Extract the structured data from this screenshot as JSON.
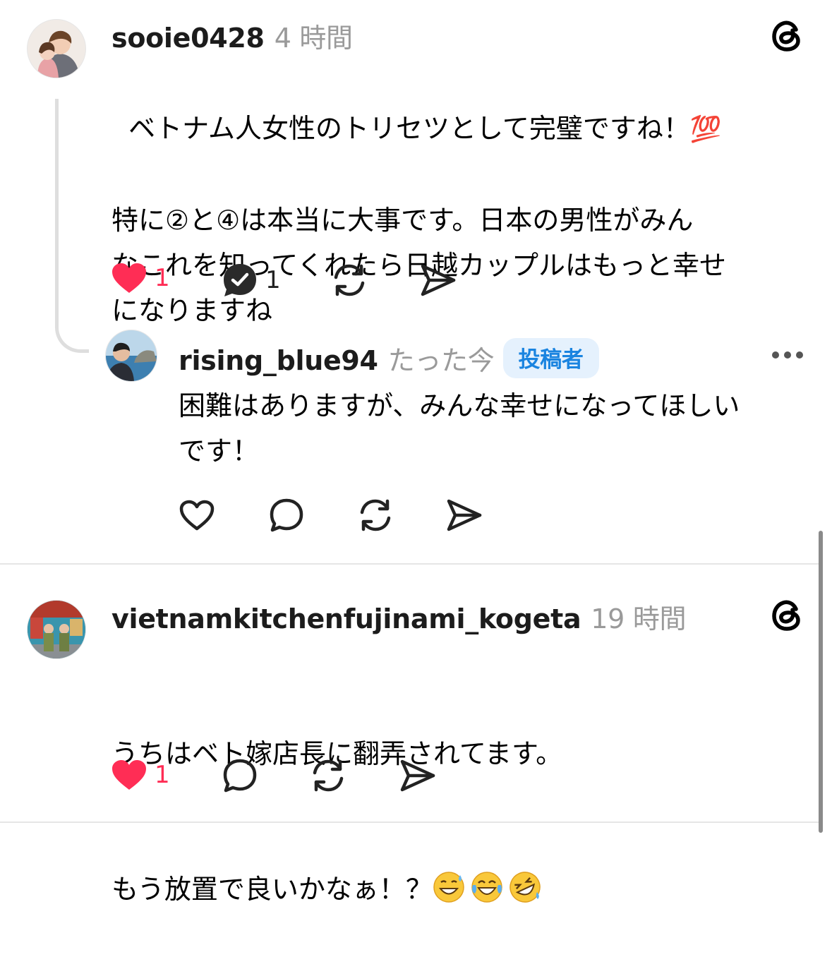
{
  "post1": {
    "username": "sooie0428",
    "time": "4 時間",
    "text_line1": "ベトナム人女性のトリセツとして完璧ですね！",
    "text_rest": "特に②と④は本当に大事です。日本の男性がみん\nなこれを知ってくれたら日越カップルはもっと幸せ\nになりますね",
    "emoji": "💯",
    "like_count": "1",
    "reply_count": "1"
  },
  "reply": {
    "username": "rising_blue94",
    "time": "たった今",
    "badge": "投稿者",
    "text": "困難はありますが、みんな幸せになってほしい\nです！"
  },
  "post2": {
    "username": "vietnamkitchenfujinami_kogeta",
    "time": "19 時間",
    "text_line1": "うちはベト嫁店長に翻弄されてます。",
    "text_line2": "もう放置で良いかなぁ！？",
    "emojis": [
      "😅",
      "😂",
      "🤣"
    ],
    "like_count": "1"
  },
  "colors": {
    "like_red": "#ff2d55",
    "badge_blue": "#1a84e0",
    "badge_bg": "#e5f1fd",
    "muted": "#9a9a9a"
  },
  "icons": [
    "threads-logo-icon",
    "heart-icon",
    "comment-icon",
    "repost-icon",
    "share-icon",
    "more-icon"
  ]
}
